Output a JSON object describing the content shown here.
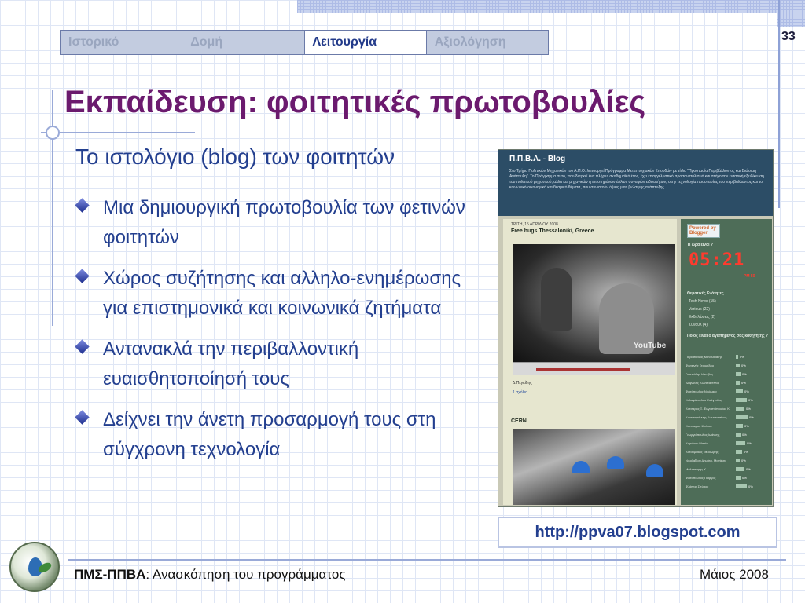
{
  "nav": {
    "tabs": [
      {
        "label": "Ιστορικό",
        "active": false
      },
      {
        "label": "Δομή",
        "active": false
      },
      {
        "label": "Λειτουργία",
        "active": true
      },
      {
        "label": "Αξιολόγηση",
        "active": false
      }
    ]
  },
  "page_number": "33",
  "title": "Εκπαίδευση: φοιτητικές πρωτοβουλίες",
  "subtitle": "Το ιστολόγιο (blog) των φοιτητών",
  "bullets": [
    "Μια δημιουργική πρωτοβουλία των φετινών φοιτητών",
    "Χώρος συζήτησης και αλληλο-ενημέρωσης για επιστημονικά και κοινωνικά ζητήματα",
    "Αντανακλά την περιβαλλοντική ευαισθητοποίησή τους",
    "Δείχνει την άνετη προσαρμογή τους στη σύγχρονη τεχνολογία"
  ],
  "blog_screenshot": {
    "title": "Π.Π.Β.Α. - Blog",
    "description": "Στο Τμήμα Πολιτικών Μηχανικών του Α.Π.Θ. λειτουργεί Πρόγραμμα Μεταπτυχιακών Σπουδών με τίτλο \"Προστασία Περιβάλλοντος και Βιώσιμη Ανάπτυξη\". Το Πρόγραμμα αυτό, που διαρκεί ένα πλήρες ακαδημαϊκό έτος, έχει επαγγελματικό προσανατολισμό και στόχο την εντατική εξειδίκευση του πολιτικού μηχανικού, αλλά και μηχανικών ή επιστημόνων άλλων συναφών ειδικοτήτων, στην τεχνολογία προστασίας του περιβάλλοντος και το κοινωνικό-οικονομικό και θεσμικό θέματα, που συνιστούν όψεις μιας βιώσιμης ανάπτυξης.",
    "post1_date": "ΤΡΙΤΗ, 15 ΑΠΡΙΛΙΟΥ 2008",
    "post1_title": "Free hugs Thessaloniki, Greece",
    "video_logo": "YouTube",
    "post1_meta": "Δ.Πεγκίδης",
    "post1_link": "1 σχόλιο",
    "post2_title": "CERN",
    "blogger_badge": "Powered by Blogger",
    "clock_label": "Τι ώρα είναι ?",
    "clock_time": "05:21",
    "clock_suffix": "PM 50",
    "categories_label": "Θεματικές Ενότητες",
    "categories": [
      "Tech News (15)",
      "Various (22)",
      "Εκδηλώσεις (2)",
      "Συναυλ (4)"
    ],
    "poll_label": "Ποιος είναι ο αγαπημένος σας καθηγητής ?",
    "poll": [
      {
        "name": "Παρασκευάς Μανουσάκης",
        "pct": "0%",
        "level": 0.1
      },
      {
        "name": "Φωτεινής Σταυρίδου",
        "pct": "0%",
        "level": 0.15
      },
      {
        "name": "Γκανούλης Ιάκωβος",
        "pct": "0%",
        "level": 0.2
      },
      {
        "name": "Δαφνίδης Κωνσταντίνος",
        "pct": "0%",
        "level": 0.15
      },
      {
        "name": "Φεσόπουλος Νικόλαος",
        "pct": "0%",
        "level": 0.3
      },
      {
        "name": "Καλαφάτογλου Ευάγγελος",
        "pct": "0%",
        "level": 0.45
      },
      {
        "name": "Κατσαρός Ξ. Ευγαστόπουλος Κ.",
        "pct": "0%",
        "level": 0.35
      },
      {
        "name": "Κουτσογιάννης Κωνσταντίνος",
        "pct": "0%",
        "level": 0.5
      },
      {
        "name": "Κοντόκρου Ιλεάτου",
        "pct": "0%",
        "level": 0.3
      },
      {
        "name": "Γεωργιόπουλος Ιωάννης",
        "pct": "0%",
        "level": 0.2
      },
      {
        "name": "Καρεΐνου Μαρία",
        "pct": "0%",
        "level": 0.4
      },
      {
        "name": "Κατουμάκος Θεοδωρής",
        "pct": "0%",
        "level": 0.25
      },
      {
        "name": "Νικολαΐδου Δημήτρ. Μανάλης",
        "pct": "0%",
        "level": 0.15
      },
      {
        "name": "Μαλισσάρης Κ.",
        "pct": "0%",
        "level": 0.35
      },
      {
        "name": "Φεσόπουλος Γιώργος",
        "pct": "0%",
        "level": 0.2
      },
      {
        "name": "Φλάινος Σπύρος",
        "pct": "0%",
        "level": 0.45
      }
    ]
  },
  "url": "http://ppva07.blogspot.com",
  "footer": {
    "left_bold": "ΠΜΣ-ΠΠΒΑ",
    "left_rest": ": Ανασκόπηση του προγράμματος",
    "right": "Μάιος 2008"
  },
  "colors": {
    "title": "#6b1a6e",
    "body_text": "#233f8f",
    "active_tab": "#223a8a",
    "inactive_tab_bg": "#c3cce0"
  }
}
